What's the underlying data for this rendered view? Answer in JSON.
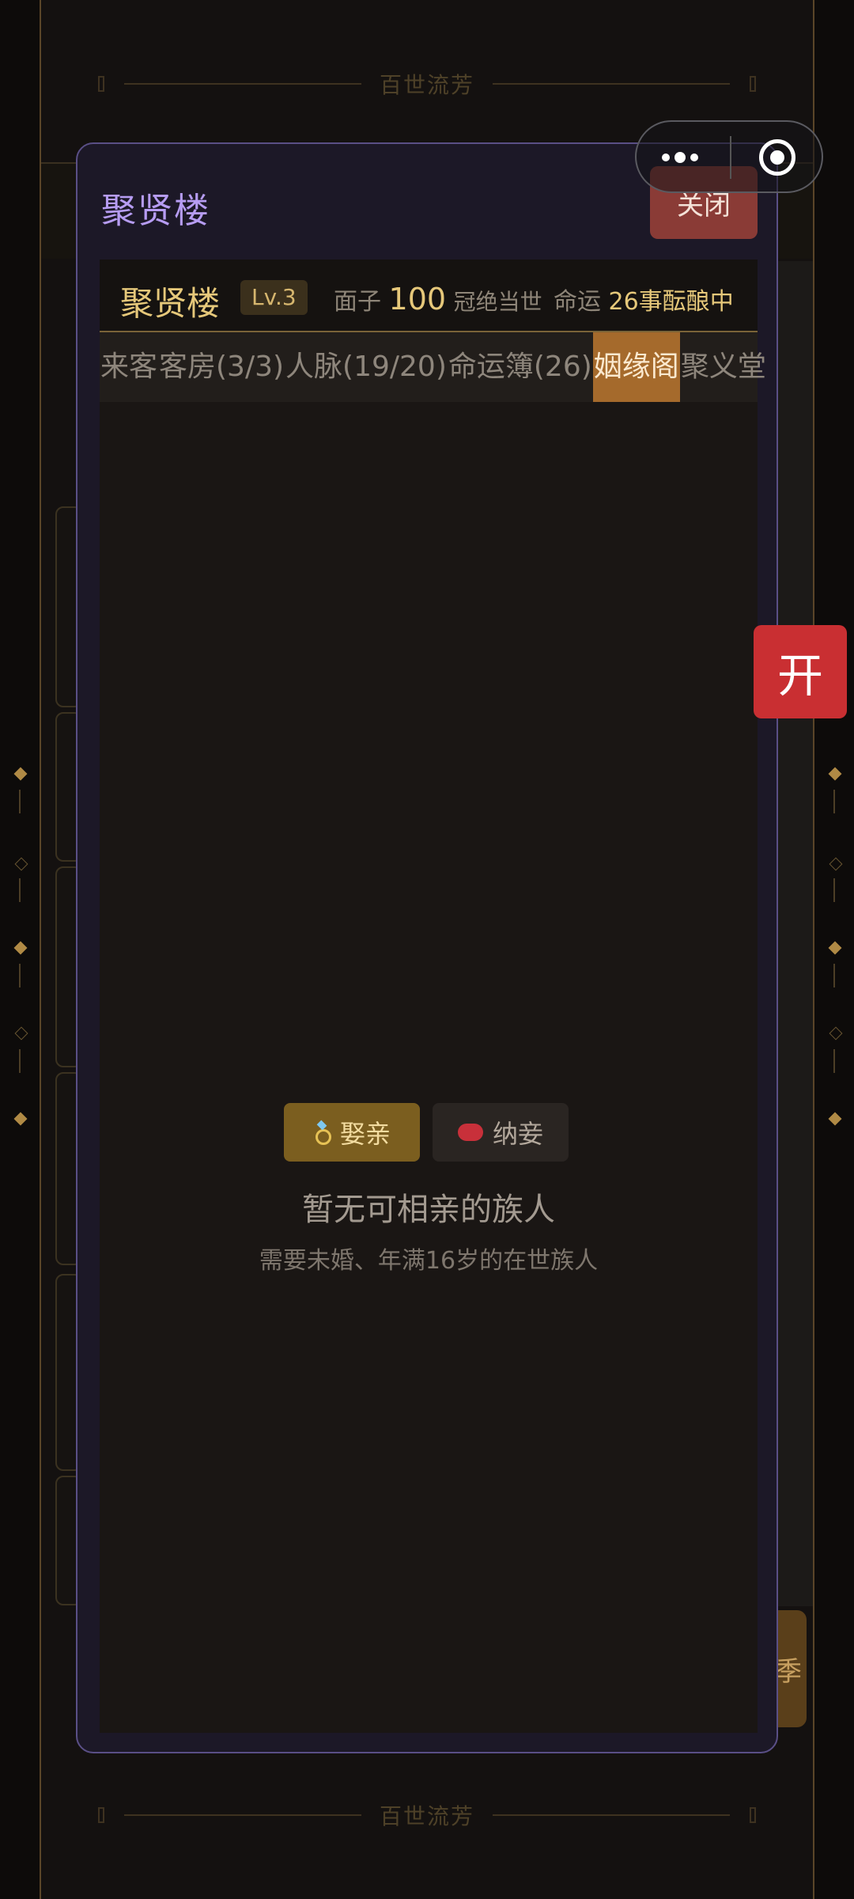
{
  "background": {
    "banner_text": "百世流芳",
    "side_button_char": "季"
  },
  "float_badge": "开",
  "modal": {
    "title": "聚贤楼",
    "close_label": "关闭",
    "info": {
      "hall_name": "聚贤楼",
      "level": "Lv.3",
      "face_label": "面子",
      "face_value": "100",
      "face_rank": "冠绝当世",
      "fate_label": "命运",
      "fate_value": "26事酝酿中"
    },
    "tabs": [
      {
        "label": "来客",
        "active": false
      },
      {
        "label": "客房(3/3)",
        "active": false
      },
      {
        "label": "人脉(19/20)",
        "active": false
      },
      {
        "label": "命运簿(26)",
        "active": false
      },
      {
        "label": "姻缘阁",
        "active": true
      },
      {
        "label": "聚义堂",
        "active": false
      }
    ],
    "segments": {
      "marry_label": "娶亲",
      "concubine_label": "纳妾"
    },
    "empty": {
      "title": "暂无可相亲的族人",
      "subtitle": "需要未婚、年满16岁的在世族人"
    }
  },
  "colors": {
    "modal_border": "#5a4f86",
    "title_purple": "#b69cf2",
    "gold": "#e6c87a",
    "active_tab": "#a56a2c",
    "close_red": "#8a3b36",
    "badge_red": "#c92f32"
  },
  "icons": [
    "ring-icon",
    "red-pill-icon",
    "more-dots-icon",
    "close-target-icon"
  ]
}
